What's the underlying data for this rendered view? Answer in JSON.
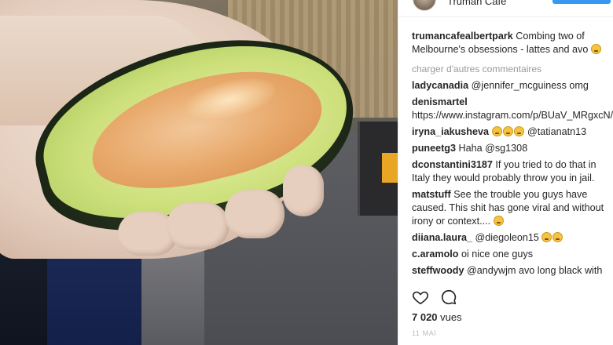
{
  "header": {
    "account_name": "Truman Cafe",
    "follow_color": "#3897f0"
  },
  "caption": {
    "user": "trumancafealbertpark",
    "text": "Combing two of Melbourne's obsessions - lattes and avo",
    "emoji": [
      "face-emoji"
    ]
  },
  "load_more_label": "charger d'autres commentaires",
  "comments": [
    {
      "user": "ladycanadia",
      "text": "@jennifer_mcguiness omg",
      "emoji_count": 0
    },
    {
      "user": "denismartel",
      "text": "https://www.instagram.com/p/BUaV_MRgxcN/",
      "emoji_count": 0
    },
    {
      "user": "iryna_iakusheva",
      "text": "@tatianatn13",
      "emoji_count": 3,
      "emoji_before_text": true
    },
    {
      "user": "puneetg3",
      "text": "Haha @sg1308",
      "emoji_count": 0
    },
    {
      "user": "dconstantini3187",
      "text": "If you tried to do that in Italy they would probably throw you in jail.",
      "emoji_count": 0
    },
    {
      "user": "matstuff",
      "text": "See the trouble you guys have caused. This shit has gone viral and without irony or context....",
      "emoji_count": 1
    },
    {
      "user": "diiana.laura_",
      "text": "@diegoleon15",
      "emoji_count": 2
    },
    {
      "user": "c.aramolo",
      "text": "oi nice one guys",
      "emoji_count": 0
    },
    {
      "user": "steffwoody",
      "text": "@andywjm avo long black with",
      "emoji_count": 0
    }
  ],
  "actions": {
    "like_icon": "heart-icon",
    "comment_icon": "comment-icon"
  },
  "stats": {
    "views_count": "7 020",
    "views_label": "vues"
  },
  "post_date": "11 MAI"
}
